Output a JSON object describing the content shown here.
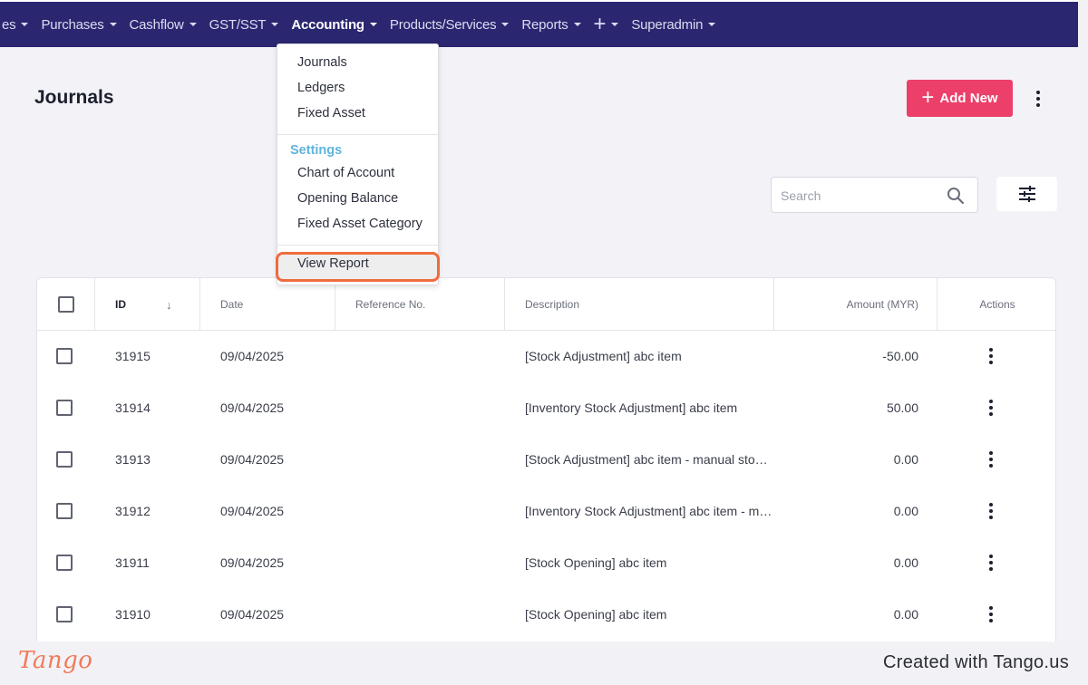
{
  "navbar": {
    "items": [
      {
        "label": "es"
      },
      {
        "label": "Purchases"
      },
      {
        "label": "Cashflow"
      },
      {
        "label": "GST/SST"
      },
      {
        "label": "Accounting"
      },
      {
        "label": "Products/Services"
      },
      {
        "label": "Reports"
      },
      {
        "label": "+"
      },
      {
        "label": "Superadmin"
      }
    ],
    "active": "Accounting"
  },
  "page": {
    "title": "Journals",
    "add_button": "Add New",
    "search_placeholder": "Search"
  },
  "dropdown": {
    "items_top": [
      "Journals",
      "Ledgers",
      "Fixed Asset"
    ],
    "settings_header": "Settings",
    "items_settings": [
      "Chart of Account",
      "Opening Balance",
      "Fixed Asset Category"
    ],
    "view_report": "View Report"
  },
  "table": {
    "columns": [
      "ID",
      "Date",
      "Reference No.",
      "Description",
      "Amount (MYR)",
      "Actions"
    ],
    "rows": [
      {
        "id": "31915",
        "date": "09/04/2025",
        "ref": "",
        "desc": "[Stock Adjustment] abc item",
        "amount": "-50.00"
      },
      {
        "id": "31914",
        "date": "09/04/2025",
        "ref": "",
        "desc": "[Inventory Stock Adjustment] abc item",
        "amount": "50.00"
      },
      {
        "id": "31913",
        "date": "09/04/2025",
        "ref": "",
        "desc": "[Stock Adjustment] abc item - manual sto…",
        "amount": "0.00"
      },
      {
        "id": "31912",
        "date": "09/04/2025",
        "ref": "",
        "desc": "[Inventory Stock Adjustment] abc item - m…",
        "amount": "0.00"
      },
      {
        "id": "31911",
        "date": "09/04/2025",
        "ref": "",
        "desc": "[Stock Opening] abc item",
        "amount": "0.00"
      },
      {
        "id": "31910",
        "date": "09/04/2025",
        "ref": "",
        "desc": "[Stock Opening] abc item",
        "amount": "0.00"
      }
    ]
  },
  "footer": {
    "logo": "Tango",
    "created": "Created with Tango.us"
  },
  "colors": {
    "navbar": "#2b2670",
    "accent": "#ec3f6a",
    "highlight": "#f06b3d",
    "settings_header": "#5fb4dd"
  }
}
